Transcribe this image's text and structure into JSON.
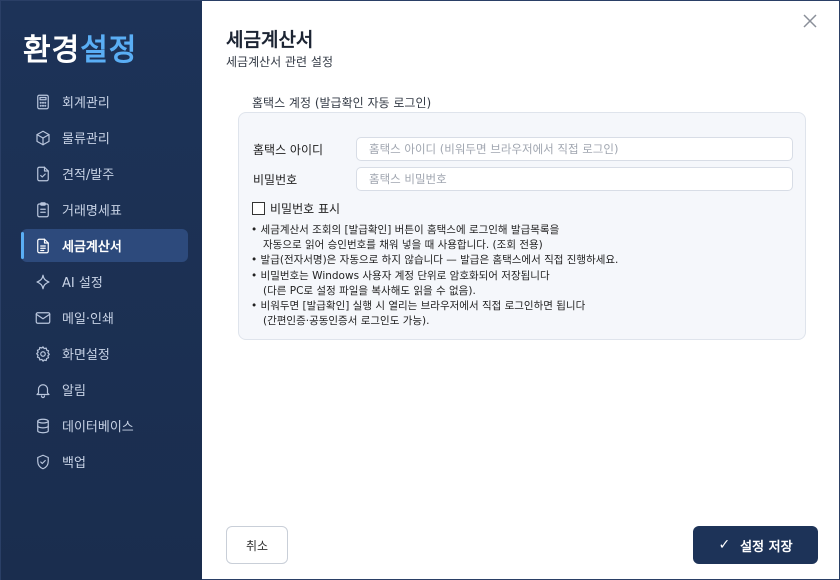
{
  "sidebar": {
    "title_main": "환경",
    "title_accent": "설정",
    "accent_color": "#5aaef5",
    "items": [
      {
        "label": "회계관리",
        "icon": "calculator-icon"
      },
      {
        "label": "물류관리",
        "icon": "box-icon"
      },
      {
        "label": "견적/발주",
        "icon": "document-check-icon"
      },
      {
        "label": "거래명세표",
        "icon": "clipboard-icon"
      },
      {
        "label": "세금계산서",
        "icon": "invoice-icon",
        "active": true
      },
      {
        "label": "AI 설정",
        "icon": "sparkle-icon"
      },
      {
        "label": "메일·인쇄",
        "icon": "mail-icon"
      },
      {
        "label": "화면설정",
        "icon": "gear-icon"
      },
      {
        "label": "알림",
        "icon": "bell-icon"
      },
      {
        "label": "데이터베이스",
        "icon": "database-icon"
      },
      {
        "label": "백업",
        "icon": "shield-check-icon"
      }
    ]
  },
  "main": {
    "title": "세금계산서",
    "subtitle": "세금계산서 관련 설정",
    "section_label": "홈택스 계정 (발급확인 자동 로그인)",
    "fields": {
      "id_label": "홈택스 아이디",
      "id_placeholder": "홈택스 아이디 (비워두면 브라우저에서 직접 로그인)",
      "id_value": "",
      "pw_label": "비밀번호",
      "pw_placeholder": "홈택스 비밀번호",
      "pw_value": ""
    },
    "show_password_label": "비밀번호 표시",
    "show_password_checked": false,
    "notes": [
      [
        "• 세금계산서 조회의 [발급확인] 버튼이 홈택스에 로그인해 발급목록을",
        "자동으로 읽어 승인번호를 채워 넣을 때 사용합니다. (조회 전용)"
      ],
      [
        "• 발급(전자서명)은 자동으로 하지 않습니다 — 발급은 홈택스에서 직접 진행하세요."
      ],
      [
        "• 비밀번호는 Windows 사용자 계정 단위로 암호화되어 저장됩니다",
        "(다른 PC로 설정 파일을 복사해도 읽을 수 없음)."
      ],
      [
        "• 비워두면 [발급확인] 실행 시 열리는 브라우저에서 직접 로그인하면 됩니다",
        "(간편인증·공동인증서 로그인도 가능)."
      ]
    ]
  },
  "footer": {
    "cancel_label": "취소",
    "save_label": "설정 저장",
    "save_icon": "checkmark-icon",
    "save_color": "#1d3358"
  }
}
